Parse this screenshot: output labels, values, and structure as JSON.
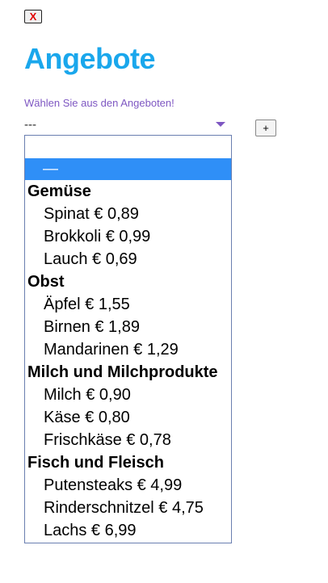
{
  "close_button": {
    "label": "X"
  },
  "page_title": "Angebote",
  "select": {
    "label": "Wählen Sie aus den Angeboten!",
    "value": "---",
    "add_label": "+"
  },
  "dropdown": {
    "selected_option": "—",
    "groups": [
      {
        "label": "Gemüse",
        "options": [
          "Spinat € 0,89",
          "Brokkoli € 0,99",
          "Lauch € 0,69"
        ]
      },
      {
        "label": "Obst",
        "options": [
          "Äpfel € 1,55",
          "Birnen € 1,89",
          "Mandarinen € 1,29"
        ]
      },
      {
        "label": "Milch und Milchprodukte",
        "options": [
          "Milch € 0,90",
          "Käse € 0,80",
          "Frischkäse € 0,78"
        ]
      },
      {
        "label": "Fisch und Fleisch",
        "options": [
          "Putensteaks € 4,99",
          "Rinderschnitzel € 4,75",
          "Lachs € 6,99"
        ]
      }
    ]
  },
  "colors": {
    "title": "#1aa7ec",
    "label": "#7e57c2",
    "highlight": "#2f8ff7",
    "close_text": "#e00000"
  }
}
